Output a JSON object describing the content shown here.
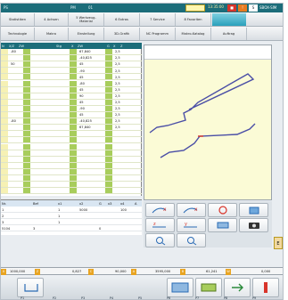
{
  "titlebar": {
    "app_label": "PS",
    "channel_label": "01",
    "pm_label": "PM",
    "mode": "Einrichten",
    "badge": "Intro",
    "status": "SBOX-SIM",
    "time": "13:35:00",
    "status_color": "#1c6d7a"
  },
  "tabs_row1": [
    "Statistiken",
    "4 Achsen",
    "5 Werkzeug-Material",
    "6 Extras",
    "7 Service",
    "8 Favoriten"
  ],
  "tabs_row2": [
    "Technologie",
    "Makro",
    "Einstellung",
    "3D-Grafik",
    "NC Programm",
    "Makro-Katalog",
    "Auftrag"
  ],
  "grid": {
    "headers": [
      "N",
      "X/Z",
      "ZW",
      "Stg",
      "X",
      "ZW",
      "G",
      "X",
      "Z"
    ],
    "rows": [
      {
        "a": "-80",
        "b": "67,840",
        "c": "2,5"
      },
      {
        "a": "",
        "b": "-40,825",
        "c": "2,5"
      },
      {
        "a": "50",
        "b": "45",
        "c": "2,5"
      },
      {
        "a": "",
        "b": "-90",
        "c": "2,5"
      },
      {
        "a": "",
        "b": "45",
        "c": "2,5"
      },
      {
        "a": "",
        "b": "-80",
        "c": "2,5"
      },
      {
        "a": "",
        "b": "45",
        "c": "2,5"
      },
      {
        "a": "",
        "b": "90",
        "c": "2,5"
      },
      {
        "a": "",
        "b": "45",
        "c": "2,5"
      },
      {
        "a": "",
        "b": "-90",
        "c": "2,5"
      },
      {
        "a": "",
        "b": "45",
        "c": "2,5"
      },
      {
        "a": "-80",
        "b": "-40,825",
        "c": "2,5"
      },
      {
        "a": "",
        "b": "67,840",
        "c": "2,5"
      },
      {
        "a": "",
        "b": "",
        "c": ""
      },
      {
        "a": "",
        "b": "",
        "c": ""
      },
      {
        "a": "",
        "b": "",
        "c": ""
      },
      {
        "a": "",
        "b": "",
        "c": ""
      },
      {
        "a": "",
        "b": "",
        "c": ""
      },
      {
        "a": "",
        "b": "",
        "c": ""
      },
      {
        "a": "",
        "b": "",
        "c": ""
      },
      {
        "a": "",
        "b": "",
        "c": ""
      },
      {
        "a": "",
        "b": "",
        "c": ""
      },
      {
        "a": "",
        "b": "",
        "c": ""
      }
    ]
  },
  "lower": {
    "headers": [
      "Nr.",
      "Bef",
      "x1",
      "x2",
      "G",
      "x3",
      "x4",
      "A"
    ],
    "rows": [
      [
        "1",
        "",
        "1",
        "5000",
        "",
        "",
        "100",
        ""
      ],
      [
        "2",
        "",
        "1",
        "",
        "",
        "",
        "",
        ""
      ],
      [
        "3",
        "",
        "1",
        "",
        "",
        "",
        "",
        ""
      ],
      [
        "5104",
        "3",
        "",
        "",
        "0",
        "",
        "",
        ""
      ]
    ]
  },
  "coords": {
    "x_label": "X",
    "x_val": "1000,000",
    "z_label": "Z",
    "z_val": "0,827",
    "c_label": "C",
    "c_val": "90,000",
    "a_label": "A",
    "a_val": "3595,000",
    "b_label": "B",
    "b_val": "61,241",
    "w_label": "W",
    "w_val": "0,000",
    "axis_color": "#e8a421"
  },
  "side_letter": "E",
  "toolbar": {
    "labels": [
      "P1",
      "P2",
      "P3",
      "P4",
      "P5",
      "P6",
      "P7",
      "P8",
      "P9"
    ]
  }
}
